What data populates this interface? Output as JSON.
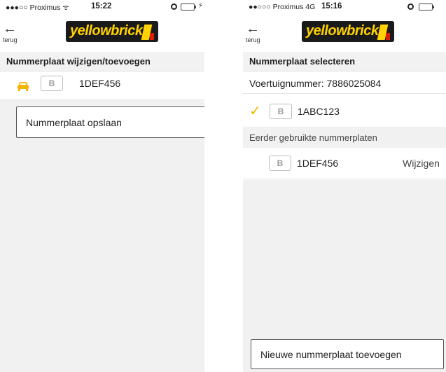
{
  "left": {
    "status": {
      "carrier": "●●●○○ Proximus ᯤ",
      "time": "15:22",
      "charge": "⚡"
    },
    "nav": {
      "back_label": "terug",
      "back_arrow": "←",
      "logo_text": "yellowbrick"
    },
    "section_title": "Nummerplaat wijzigen/toevoegen",
    "plate": {
      "country": "B",
      "number": "1DEF456"
    },
    "save_button": "Nummerplaat opslaan"
  },
  "right": {
    "status": {
      "carrier": "●●○○○ Proximus  4G",
      "time": "15:16"
    },
    "nav": {
      "back_label": "terug",
      "back_arrow": "←",
      "logo_text": "yellowbrick"
    },
    "section_title": "Nummerplaat selecteren",
    "vehicle_number_label": "Voertuignummer: 7886025084",
    "selected_plate": {
      "check": "✓",
      "country": "B",
      "number": "1ABC123"
    },
    "previous_header": "Eerder gebruikte nummerplaten",
    "previous_plates": [
      {
        "country": "B",
        "number": "1DEF456",
        "action": "Wijzigen"
      }
    ],
    "add_button": "Nieuwe nummerplaat toevoegen"
  },
  "colors": {
    "brand_yellow": "#ffd200",
    "brand_red": "#d81e05",
    "accent_orange": "#f5b400"
  }
}
